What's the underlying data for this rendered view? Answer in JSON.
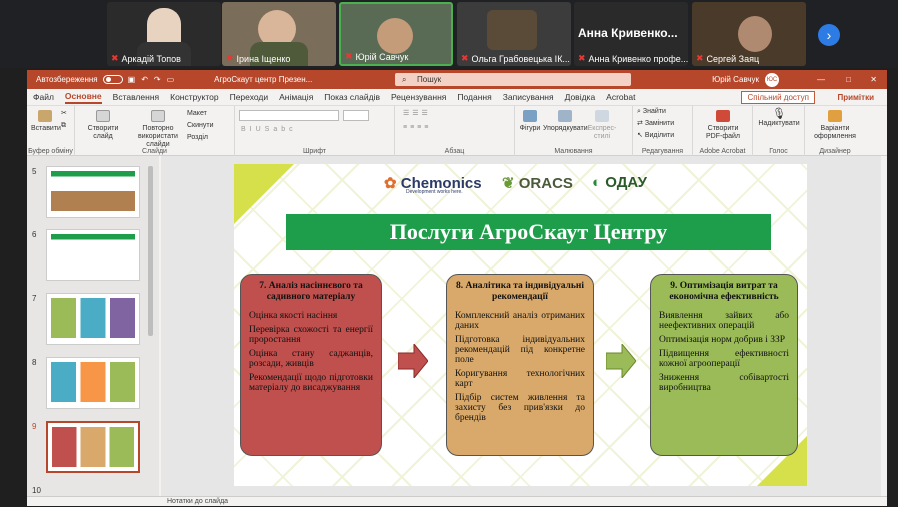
{
  "participants": [
    {
      "name": "Аркадій Топов",
      "bg": "#2c2c2c",
      "face": "#e8d2c0"
    },
    {
      "name": "Ірина Іщенко",
      "bg": "#7a6d5a",
      "face": "#d9b59a"
    },
    {
      "name": "Юрій Савчук",
      "bg": "#5a6b55",
      "face": "#c59c7a"
    },
    {
      "name": "Ольга Грабовецька ІК...",
      "bg": "#3c3c3c",
      "face": "#6a5a48"
    },
    {
      "name": "Анна Кривенко профе...",
      "big": "Анна  Кривенко...",
      "bg": "#2a2a2a"
    },
    {
      "name": "Сергей Заяц",
      "bg": "#4a3a2a",
      "face": "#b08a70"
    }
  ],
  "title": {
    "autosave": "Автозбереження",
    "filename": "АгроСкаут центр Презен...",
    "search": "Пошук",
    "user": "Юрій Савчук",
    "initials": "ЮС"
  },
  "tabs": [
    "Файл",
    "Основне",
    "Вставлення",
    "Конструктор",
    "Переходи",
    "Анімація",
    "Показ слайдів",
    "Рецензування",
    "Подання",
    "Записування",
    "Довідка",
    "Acrobat"
  ],
  "share": "Спільний доступ",
  "notes_btn": "Примітки",
  "ribbon": {
    "paste": "Вставити",
    "clipboard": "Буфер обміну",
    "new_slide": "Створити слайд",
    "reuse": "Повторно використати слайди",
    "layout": "Макет",
    "reset": "Скинути",
    "section": "Розділ",
    "slides": "Слайди",
    "font": "Шрифт",
    "paragraph": "Абзац",
    "shapes": "Фігури",
    "arrange": "Упорядкувати",
    "quickstyles": "Експрес-стилі",
    "drawing": "Малювання",
    "find": "Знайти",
    "replace": "Замінити",
    "select": "Виділити",
    "editing": "Редагування",
    "create_pdf": "Створити PDF-файл",
    "adobe": "Adobe Acrobat",
    "dictate": "Надиктувати",
    "voice": "Голос",
    "designer_btn": "Варіанти оформлення",
    "designer": "Дизайнер"
  },
  "thumbs": [
    "5",
    "6",
    "7",
    "8",
    "9",
    "10"
  ],
  "slide": {
    "logos": [
      "Chemonics",
      "ORACS",
      "ОДАУ"
    ],
    "tagline": "Development works here.",
    "banner": "Послуги АгроСкаут Центру",
    "box1": {
      "title": "7. Аналіз насіннєвого та садивного матеріалу",
      "items": [
        "Оцінка якості насіння",
        "Перевірка схожості та енергії проростання",
        "Оцінка стану саджанців, розсади, живців",
        "Рекомендації щодо підготовки матеріалу до висаджування"
      ],
      "color": "#c0504d"
    },
    "box2": {
      "title": "8. Аналітика та індивідуальні рекомендації",
      "items": [
        "Комплексний аналіз отриманих даних",
        "Підготовка індивідуальних рекомендацій під конкретне поле",
        "Коригування технологічних карт",
        "Підбір систем живлення та захисту без прив'язки до брендів"
      ],
      "color": "#d8a96a"
    },
    "box3": {
      "title": "9. Оптимізація витрат та економічна ефективність",
      "items": [
        "Виявлення зайвих або неефективних операцій",
        "Оптимізація норм добрив і ЗЗР",
        "Підвищення ефективності кожної агрооперації",
        "Зниження собівартості виробництва"
      ],
      "color": "#9bbb59"
    }
  },
  "notes_placeholder": "Нотатки до слайда"
}
